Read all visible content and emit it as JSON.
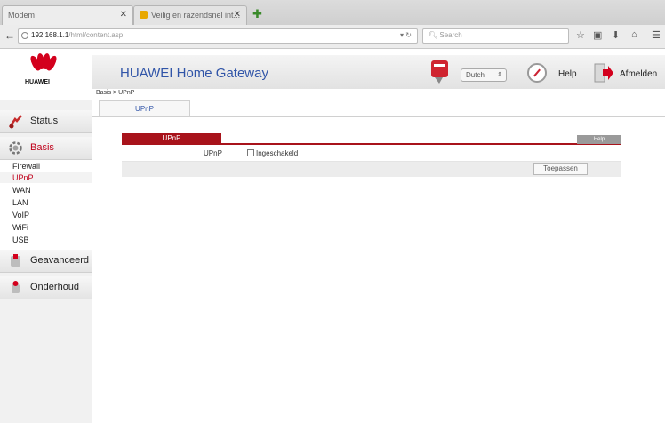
{
  "browser": {
    "tabs": [
      {
        "title": "Modem"
      },
      {
        "title": "Veilig en razendsnel int..."
      }
    ],
    "url_host": "192.168.1.1",
    "url_path": "/html/content.asp",
    "search_placeholder": "Search"
  },
  "router": {
    "brand": "HUAWEI",
    "title": "HUAWEI Home Gateway",
    "language": "Dutch",
    "help_label": "Help",
    "logout_label": "Afmelden",
    "breadcrumb": "Basis > UPnP",
    "subtab": "UPnP"
  },
  "sidebar": {
    "status": "Status",
    "basis": "Basis",
    "basis_items": [
      "Firewall",
      "UPnP",
      "WAN",
      "LAN",
      "VoIP",
      "WiFi",
      "USB"
    ],
    "selected_item": "UPnP",
    "advanced": "Geavanceerd",
    "maintenance": "Onderhoud"
  },
  "panel": {
    "tab_label": "UPnP",
    "help_label": "Help",
    "field_label": "UPnP",
    "checkbox_label": "Ingeschakeld",
    "checkbox_checked": false,
    "apply_label": "Toepassen"
  },
  "colors": {
    "brand_red": "#a8131b",
    "link_blue": "#3155a8"
  }
}
